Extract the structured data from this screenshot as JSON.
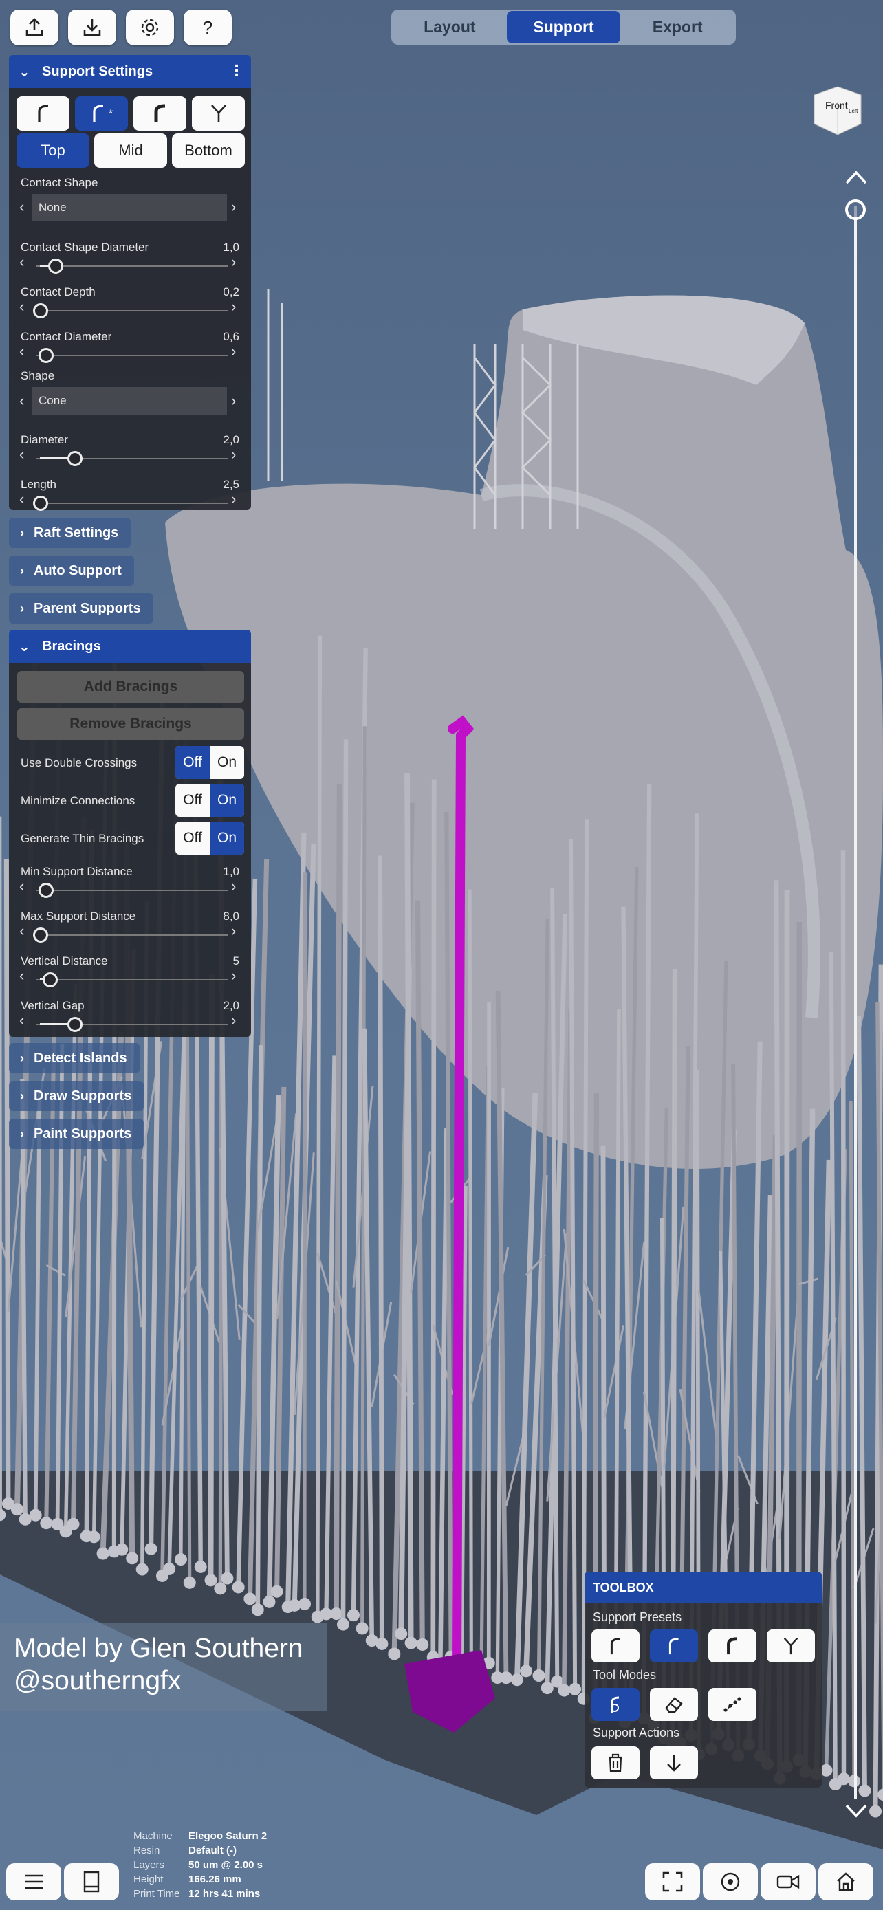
{
  "top_bar": {
    "icons": [
      "upload-icon",
      "download-icon",
      "gear-icon",
      "help-icon"
    ],
    "tabs": [
      "Layout",
      "Support",
      "Export"
    ],
    "active_tab": "Support"
  },
  "support_settings": {
    "title": "Support Settings",
    "presets": [
      "support-preset-1-icon",
      "support-preset-2-icon",
      "support-preset-3-icon",
      "support-preset-4-icon"
    ],
    "active_preset_index": 1,
    "segments": [
      "Top",
      "Mid",
      "Bottom"
    ],
    "active_segment": "Top",
    "contact_shape": {
      "label": "Contact Shape",
      "value": "None"
    },
    "contact_shape_diameter": {
      "label": "Contact Shape Diameter",
      "value": "1,0",
      "level": 0.08
    },
    "contact_depth": {
      "label": "Contact Depth",
      "value": "0,2",
      "level": 0.0
    },
    "contact_diameter": {
      "label": "Contact Diameter",
      "value": "0,6",
      "level": 0.03
    },
    "shape": {
      "label": "Shape",
      "value": "Cone"
    },
    "diameter": {
      "label": "Diameter",
      "value": "2,0",
      "level": 0.18
    },
    "length": {
      "label": "Length",
      "value": "2,5",
      "level": 0.0
    }
  },
  "collapsed_sections": {
    "raft": "Raft Settings",
    "auto": "Auto Support",
    "parent": "Parent Supports"
  },
  "bracings": {
    "title": "Bracings",
    "add_button": "Add Bracings",
    "remove_button": "Remove Bracings",
    "toggle_off": "Off",
    "toggle_on": "On",
    "double_crossings": {
      "label": "Use Double Crossings",
      "state": "Off"
    },
    "minimize_connections": {
      "label": "Minimize Connections",
      "state": "On"
    },
    "thin_bracings": {
      "label": "Generate Thin Bracings",
      "state": "On"
    },
    "min_support_distance": {
      "label": "Min Support Distance",
      "value": "1,0",
      "level": 0.03
    },
    "max_support_distance": {
      "label": "Max Support Distance",
      "value": "8,0",
      "level": 0.0
    },
    "vertical_distance": {
      "label": "Vertical Distance",
      "value": "5",
      "level": 0.05
    },
    "vertical_gap": {
      "label": "Vertical Gap",
      "value": "2,0",
      "level": 0.18
    }
  },
  "lower_sections": {
    "detect_islands": "Detect Islands",
    "draw_supports": "Draw Supports",
    "paint_supports": "Paint Supports"
  },
  "toolbox": {
    "title": "TOOLBOX",
    "support_presets_label": "Support Presets",
    "tool_modes_label": "Tool Modes",
    "support_actions_label": "Support Actions",
    "active_preset_index": 1,
    "active_mode_index": 0
  },
  "credit": {
    "line1": "Model by Glen Southern",
    "line2": "@southerngfx"
  },
  "print_info": {
    "machine_label": "Machine",
    "machine": "Elegoo Saturn 2",
    "resin_label": "Resin",
    "resin": "Default (-)",
    "layers_label": "Layers",
    "layers": "50 um @ 2.00 s",
    "height_label": "Height",
    "height": "166.26 mm",
    "print_time_label": "Print Time",
    "print_time": "12 hrs 41 mins"
  },
  "view_cube": {
    "front": "Front",
    "left": "Left"
  },
  "colors": {
    "accent": "#1f48a8",
    "selected_support": "#c010c8",
    "support_gray": "#b7b7c0",
    "model_gray": "#9fa0a8"
  }
}
